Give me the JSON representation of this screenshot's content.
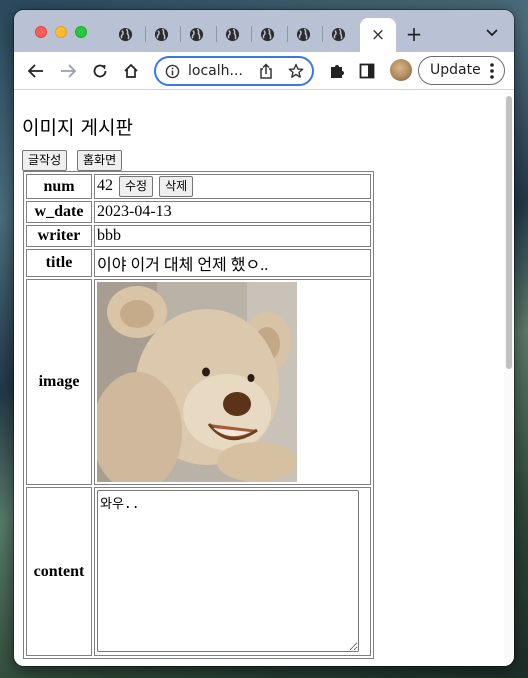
{
  "browser": {
    "tabs_count": 7,
    "active_tab_close": "×",
    "new_tab": "+",
    "omnibox_text": "localh...",
    "update_label": "Update"
  },
  "page": {
    "title": "이미지 게시판",
    "buttons": {
      "write": "글작성",
      "home": "홈화면"
    }
  },
  "post": {
    "rows": {
      "num": {
        "label": "num",
        "value": "42"
      },
      "w_date": {
        "label": "w_date",
        "value": "2023-04-13"
      },
      "writer": {
        "label": "writer",
        "value": "bbb"
      },
      "title": {
        "label": "title",
        "value": "이야 이거 대체 언제 했ㅇ.."
      },
      "image": {
        "label": "image"
      },
      "content": {
        "label": "content",
        "value": "와우.."
      }
    },
    "edit_label": "수정",
    "delete_label": "삭제"
  }
}
